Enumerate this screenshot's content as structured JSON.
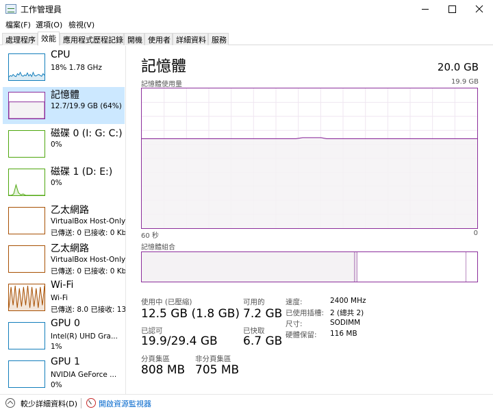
{
  "window": {
    "title": "工作管理員"
  },
  "menu": [
    "檔案(F)",
    "選項(O)",
    "檢視(V)"
  ],
  "tabs": [
    "處理程序",
    "效能",
    "應用程式歷程記錄",
    "開機",
    "使用者",
    "詳細資料",
    "服務"
  ],
  "active_tab": 1,
  "sidebar": [
    {
      "title": "CPU",
      "sub": "18%  1.78 GHz",
      "sub2": "",
      "color": "#117dbb",
      "graph": [
        0.12,
        0.18,
        0.15,
        0.22,
        0.16,
        0.14,
        0.25,
        0.2,
        0.3,
        0.18,
        0.15,
        0.2,
        0.17,
        0.28,
        0.16,
        0.22,
        0.14,
        0.3,
        0.18,
        0.16,
        0.2,
        0.22,
        0.18,
        0.15,
        0.25,
        0.19
      ]
    },
    {
      "title": "記憶體",
      "sub": "12.7/19.9 GB (64%)",
      "sub2": "",
      "color": "#8b2d9b",
      "level": 0.64
    },
    {
      "title": "磁碟 0 (I: G: C:)",
      "sub": "0%",
      "sub2": "",
      "color": "#4da60c",
      "graph": []
    },
    {
      "title": "磁碟 1 (D: E:)",
      "sub": "0%",
      "sub2": "",
      "color": "#4da60c",
      "graph": [
        0,
        0,
        0.05,
        0.4,
        0.1,
        0.02,
        0.05,
        0,
        0,
        0,
        0,
        0,
        0,
        0,
        0,
        0
      ]
    },
    {
      "title": "乙太網路",
      "sub": "VirtualBox Host-Only ...",
      "sub2": "已傳送: 0 已接收: 0 Kbps",
      "color": "#a74f01",
      "graph": []
    },
    {
      "title": "乙太網路",
      "sub": "VirtualBox Host-Only ...",
      "sub2": "已傳送: 0 已接收: 0 Kbps",
      "color": "#a74f01",
      "graph": []
    },
    {
      "title": "Wi-Fi",
      "sub": "Wi-Fi",
      "sub2": "已傳送: 8.0 已接收: 136",
      "color": "#a74f01",
      "graph": [
        0.1,
        0.9,
        0.2,
        0.95,
        0.1,
        0.85,
        0.15,
        0.9,
        0.2,
        0.95,
        0.1,
        0.9,
        0.15,
        0.85,
        0.1,
        0.9,
        0.2,
        0.95
      ]
    },
    {
      "title": "GPU 0",
      "sub": "Intel(R) UHD Gra...",
      "sub2": "1%",
      "color": "#117dbb",
      "graph": []
    },
    {
      "title": "GPU 1",
      "sub": "NVIDIA GeForce ...",
      "sub2": "0%",
      "color": "#117dbb",
      "graph": []
    }
  ],
  "main": {
    "title": "記憶體",
    "total": "20.0 GB",
    "graph_label": "記憶體使用量",
    "graph_max": "19.9 GB",
    "axis_left": "60 秒",
    "axis_right": "0",
    "composition_label": "記憶體組合",
    "usage_level": 0.64,
    "composition": {
      "in_use": 0.633,
      "modified": 0.01,
      "standby": 0.325,
      "free": 0.03
    }
  },
  "stats": {
    "in_use_label": "使用中 (已壓縮)",
    "in_use_value": "12.5 GB (1.8 GB)",
    "available_label": "可用的",
    "available_value": "7.2 GB",
    "committed_label": "已認可",
    "committed_value": "19.9/29.4 GB",
    "cached_label": "已快取",
    "cached_value": "6.7 GB",
    "paged_label": "分頁集區",
    "paged_value": "808 MB",
    "nonpaged_label": "非分頁集區",
    "nonpaged_value": "705 MB"
  },
  "props": [
    {
      "label": "速度:",
      "value": "2400 MHz"
    },
    {
      "label": "已使用插槽:",
      "value": "2 (總共 2)"
    },
    {
      "label": "尺寸:",
      "value": "SODIMM"
    },
    {
      "label": "硬體保留:",
      "value": "116 MB"
    }
  ],
  "footer": {
    "fewer": "較少詳細資料(D)",
    "resmon": "開啟資源監視器"
  },
  "colors": {
    "memory": "#8b2d9b",
    "memory_fill": "#f4f2f4",
    "selected": "#cce8ff"
  }
}
